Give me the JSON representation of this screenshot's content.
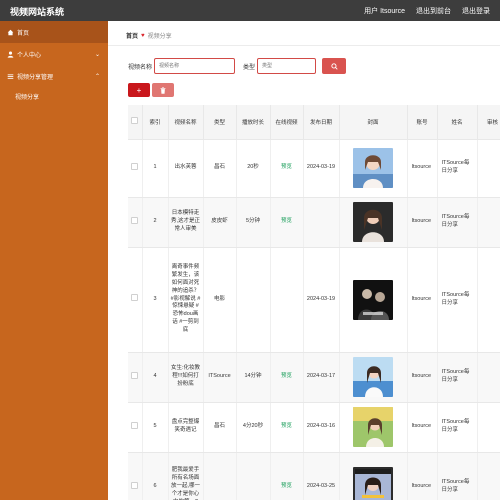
{
  "app": {
    "title": "视频网站系统",
    "nav": [
      "用户 Itsource",
      "退出到前台",
      "退出登录"
    ]
  },
  "sidebar": {
    "items": [
      {
        "label": "首页",
        "icon": "home-icon"
      },
      {
        "label": "个人中心",
        "icon": "user-icon"
      },
      {
        "label": "视频分享管理",
        "icon": "list-icon"
      }
    ],
    "sub_items": [
      {
        "label": "视频分享"
      }
    ]
  },
  "breadcrumb": {
    "home": "首页",
    "current": "视频分享"
  },
  "search": {
    "name_label": "视频名称",
    "name_placeholder": "视频名称",
    "type_label": "类型",
    "type_placeholder": "类型"
  },
  "table": {
    "headers": [
      "索引",
      "视频名称",
      "类型",
      "播放时长",
      "在线视频",
      "发布日期",
      "封面",
      "账号",
      "姓名",
      "审核"
    ],
    "rows": [
      {
        "index": "1",
        "name": "出水芙蓉",
        "type": "昌石",
        "duration": "20秒",
        "online": "预览",
        "date": "2024-03-19",
        "account": "Itsource",
        "author": "ITSource每日分享"
      },
      {
        "index": "2",
        "name": "日本模特走秀,这才是正常人审美",
        "type": "皮皮虾",
        "duration": "5分钟",
        "online": "预览",
        "date": "",
        "account": "Itsource",
        "author": "ITSource每日分享"
      },
      {
        "index": "3",
        "name": "离奇事件频繁发生，该如何面对死神的追杀？ #影视解说 #惊悚悬疑 #恐怖dou画话 #一剪到底",
        "type": "电影",
        "duration": "",
        "online": "",
        "date": "2024-03-19",
        "account": "Itsource",
        "author": "ITSource每日分享"
      },
      {
        "index": "4",
        "name": "女生:化妆教程!!!如何打扮粉底",
        "type": "ITSource",
        "duration": "14分钟",
        "online": "预览",
        "date": "2024-03-17",
        "account": "Itsource",
        "author": "ITSource每日分享"
      },
      {
        "index": "5",
        "name": "盘点完整爆笑奇遇记",
        "type": "昌石",
        "duration": "4分20秒",
        "online": "预览",
        "date": "2024-03-16",
        "account": "Itsource",
        "author": "ITSource每日分享"
      },
      {
        "index": "6",
        "name": "肥我最爱手所有名场面放一起,哪一个才是你心中的第一?",
        "type": "",
        "duration": "",
        "online": "预览",
        "date": "2024-03-25",
        "account": "Itsource",
        "author": "ITSource每日分享"
      }
    ]
  },
  "colors": {
    "topbar": "#3d3d3d",
    "sidebar": "#c7661e",
    "accent_red": "#d9534f",
    "online_green": "#1a9e5a"
  }
}
